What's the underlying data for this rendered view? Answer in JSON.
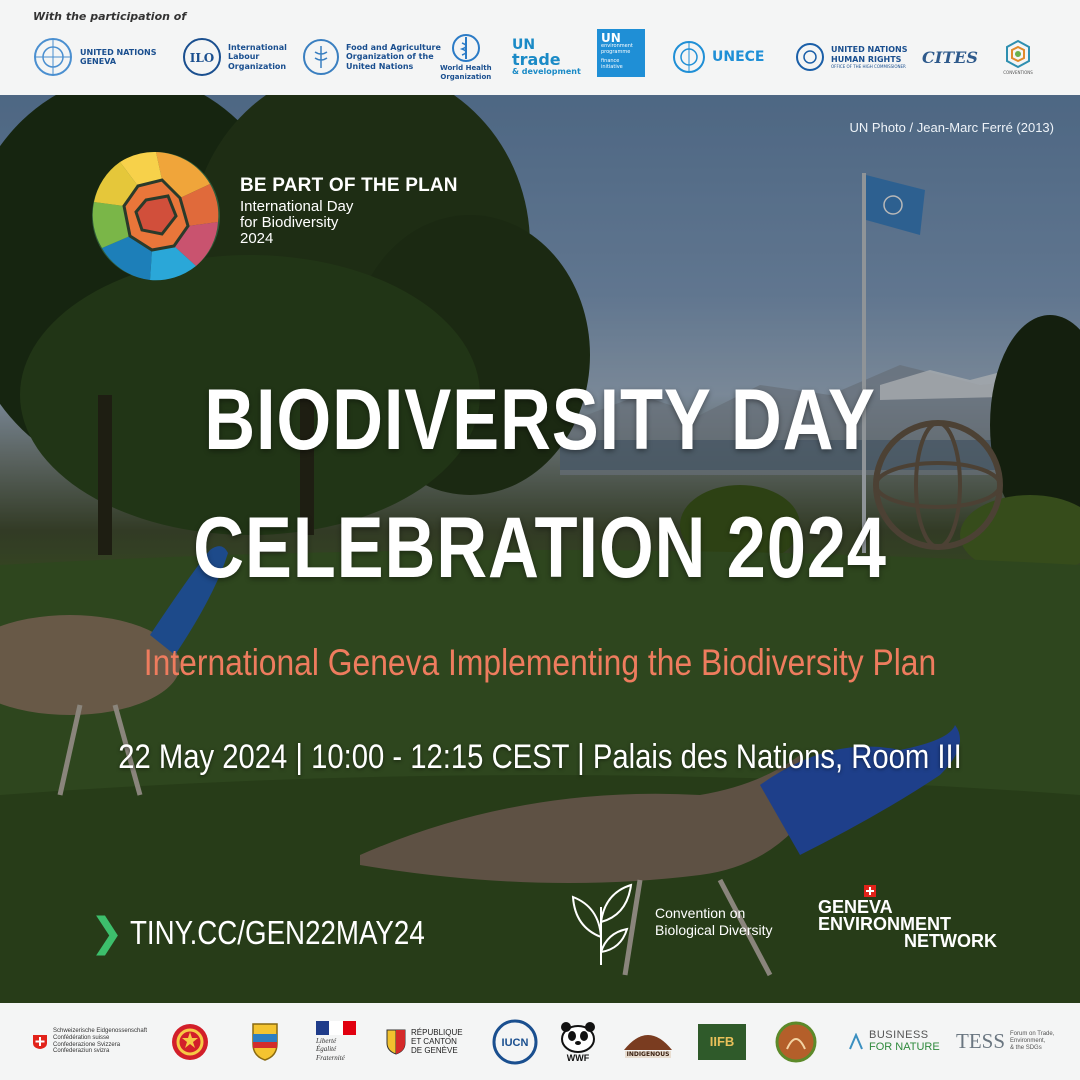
{
  "participation_label": "With the participation of",
  "top_partners": {
    "un_geneva": "UNITED NATIONS\nGENEVA",
    "ilo": "International\nLabour\nOrganization",
    "fao": "Food and Agriculture\nOrganization of the\nUnited Nations",
    "who": "World Health\nOrganization",
    "unctad_un": "UN",
    "unctad_trade": "trade",
    "unctad_dev": "& development",
    "unep_un": "UN",
    "unep_text": "environment\nprogramme",
    "unep_fi": "finance\ninitiative",
    "unece": "UNECE",
    "ohchr": "UNITED NATIONS\nHUMAN RIGHTS",
    "ohchr_sub": "OFFICE OF THE HIGH COMMISSIONER",
    "cites": "CITES",
    "brs": "CONVENTIONS"
  },
  "photo_credit": "UN Photo / Jean-Marc Ferré (2013)",
  "plan": {
    "title": "BE PART OF THE PLAN",
    "subtitle": "International Day\nfor Biodiversity\n2024"
  },
  "title_line1": "BIODIVERSITY DAY",
  "title_line2": "CELEBRATION 2024",
  "subtitle": "International Geneva Implementing the Biodiversity Plan",
  "details": "22 May 2024 | 10:00 - 12:15 CEST | Palais des Nations, Room III",
  "link": "TINY.CC/GEN22MAY24",
  "cbd_text": "Convention on\nBiological Diversity",
  "gen_line1": "GENEVA",
  "gen_line2": "ENVIRONMENT",
  "gen_line3": "NETWORK",
  "bottom_partners": {
    "swiss": "Schweizerische Eidgenossenschaft\nConfédération suisse\nConfederazione Svizzera\nConfederaziun svizra",
    "france": "Liberté\nÉgalité\nFraternité",
    "geneve": "RÉPUBLIQUE\nET CANTON\nDE GENÈVE",
    "iucn": "IUCN",
    "wwf": "WWF",
    "indigenous": "INDIGENOUS",
    "iifb": "IIFB",
    "business_top": "BUSINESS",
    "business_bottom": "FOR NATURE",
    "tess": "TESS",
    "tess_sub": "Forum on Trade,\nEnvironment,\n& the SDGs"
  },
  "colors": {
    "accent_subtitle": "#ee7c5e",
    "link_chevron": "#3dbf6c",
    "un_blue": "#1a4f8f",
    "band_bg": "#f4f5f5"
  }
}
